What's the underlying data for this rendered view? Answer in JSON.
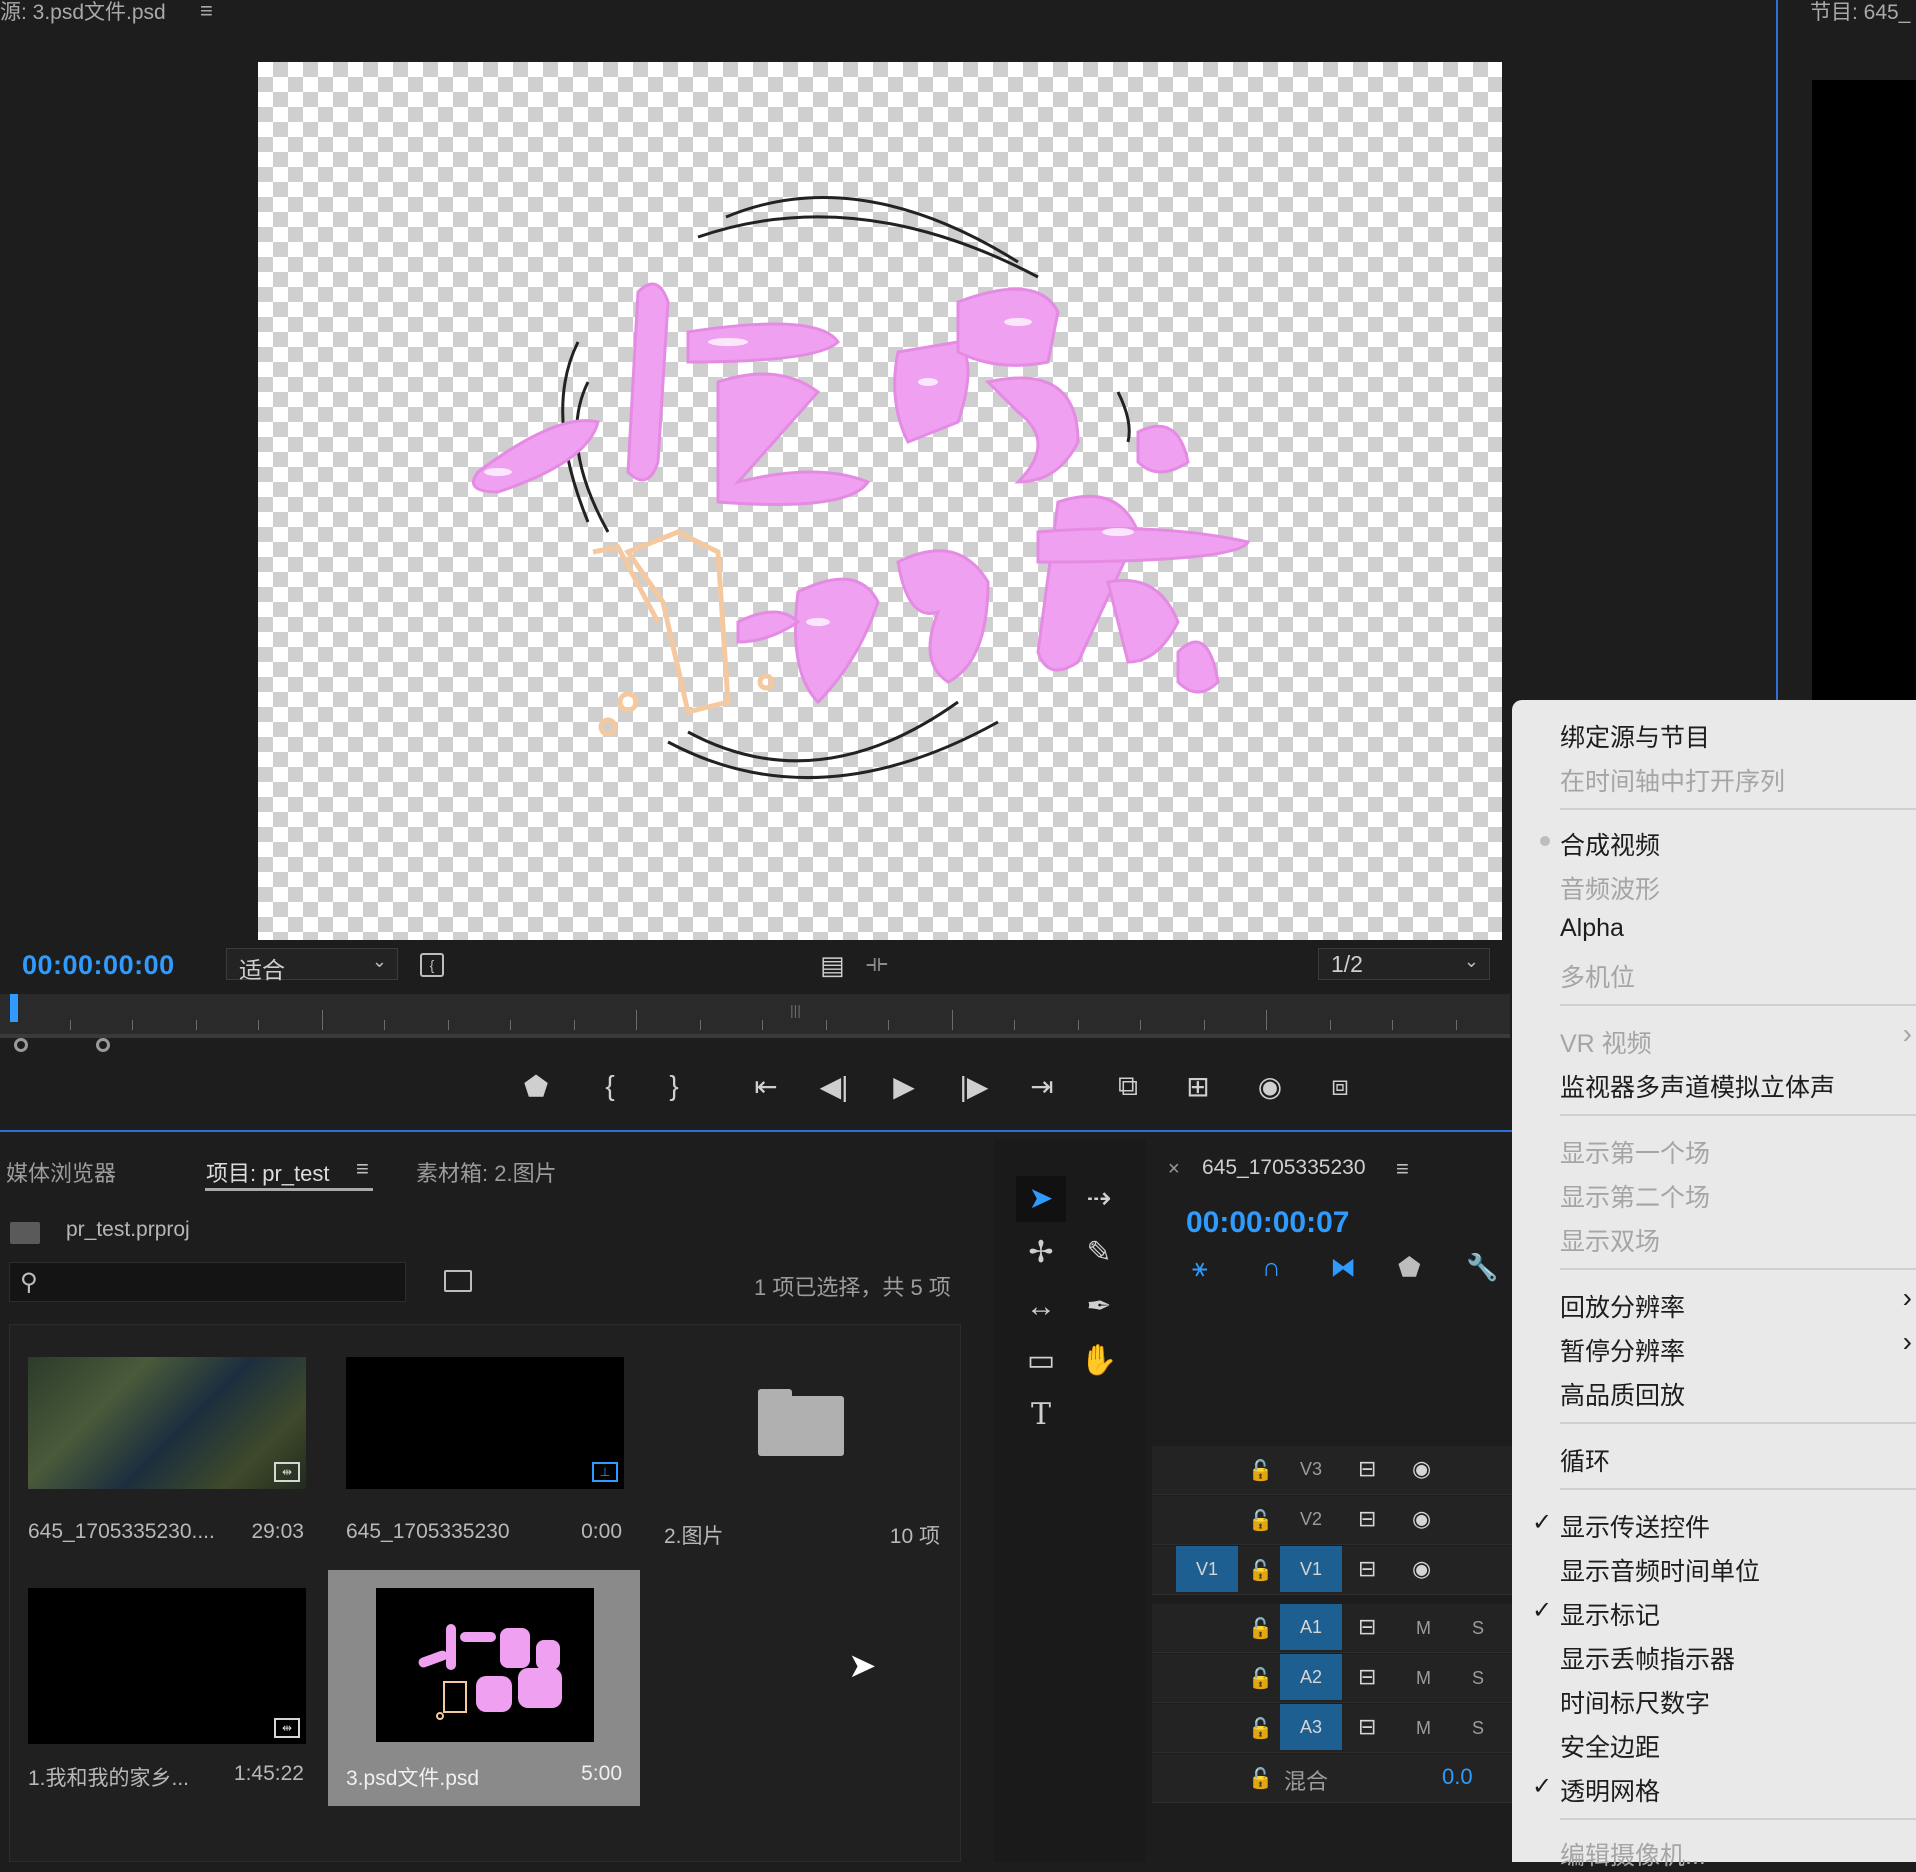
{
  "source_monitor": {
    "title": "源: 3.psd文件.psd",
    "menu_icon": "≡",
    "timecode": "00:00:00:00",
    "fit_label": "适合",
    "resolution_label": "1/2"
  },
  "program_monitor": {
    "title": "节目: 645_"
  },
  "project_panel": {
    "tabs": [
      "媒体浏览器",
      "项目: pr_test",
      "素材箱: 2.图片"
    ],
    "menu_icon": "≡",
    "project_file": "pr_test.prproj",
    "search_placeholder": "",
    "status": "1 项已选择，共 5 项",
    "items": [
      {
        "name": "645_1705335230....",
        "duration": "29:03"
      },
      {
        "name": "645_1705335230",
        "duration": "0:00"
      },
      {
        "name": "2.图片",
        "duration": "10 项"
      },
      {
        "name": "1.我和我的家乡...",
        "duration": "1:45:22"
      },
      {
        "name": "3.psd文件.psd",
        "duration": "5:00"
      }
    ]
  },
  "timeline": {
    "close": "×",
    "title": "645_1705335230",
    "menu_icon": "≡",
    "timecode": "00:00:00:07",
    "tracks": [
      {
        "src": "",
        "label": "V3"
      },
      {
        "src": "",
        "label": "V2"
      },
      {
        "src": "V1",
        "label": "V1"
      },
      {
        "src": "",
        "label": "A1",
        "m": "M",
        "s": "S"
      },
      {
        "src": "",
        "label": "A2",
        "m": "M",
        "s": "S"
      },
      {
        "src": "",
        "label": "A3",
        "m": "M",
        "s": "S"
      }
    ],
    "mix_label": "混合",
    "mix_value": "0.0"
  },
  "context_menu": {
    "items": [
      {
        "label": "绑定源与节目",
        "disabled": false
      },
      {
        "label": "在时间轴中打开序列",
        "disabled": true
      },
      {
        "label": "合成视频",
        "disabled": false
      },
      {
        "label": "音频波形",
        "disabled": true
      },
      {
        "label": "Alpha",
        "disabled": false
      },
      {
        "label": "多机位",
        "disabled": true
      },
      {
        "label": "VR 视频",
        "disabled": true
      },
      {
        "label": "监视器多声道模拟立体声",
        "disabled": false
      },
      {
        "label": "显示第一个场",
        "disabled": true
      },
      {
        "label": "显示第二个场",
        "disabled": true
      },
      {
        "label": "显示双场",
        "disabled": true
      },
      {
        "label": "回放分辨率",
        "disabled": false
      },
      {
        "label": "暂停分辨率",
        "disabled": false
      },
      {
        "label": "高品质回放",
        "disabled": false
      },
      {
        "label": "循环",
        "disabled": false
      },
      {
        "label": "显示传送控件",
        "checked": true
      },
      {
        "label": "显示音频时间单位",
        "disabled": false
      },
      {
        "label": "显示标记",
        "checked": true
      },
      {
        "label": "显示丢帧指示器",
        "disabled": false
      },
      {
        "label": "时间标尺数字",
        "disabled": false
      },
      {
        "label": "安全边距",
        "disabled": false
      },
      {
        "label": "透明网格",
        "checked": true
      },
      {
        "label": "编辑摄像机...",
        "disabled": true
      }
    ],
    "check_glyph": "✓",
    "submenu_glyph": "›"
  },
  "canvas_art": {
    "text": "一起喝奶茶"
  },
  "thumb_art": {
    "text": "一起喝奶茶"
  },
  "colors": {
    "accent": "#2f9bff",
    "track_on": "#1e5f91",
    "art_pink": "#f0a0f0",
    "art_orange": "#f5c9a0"
  }
}
